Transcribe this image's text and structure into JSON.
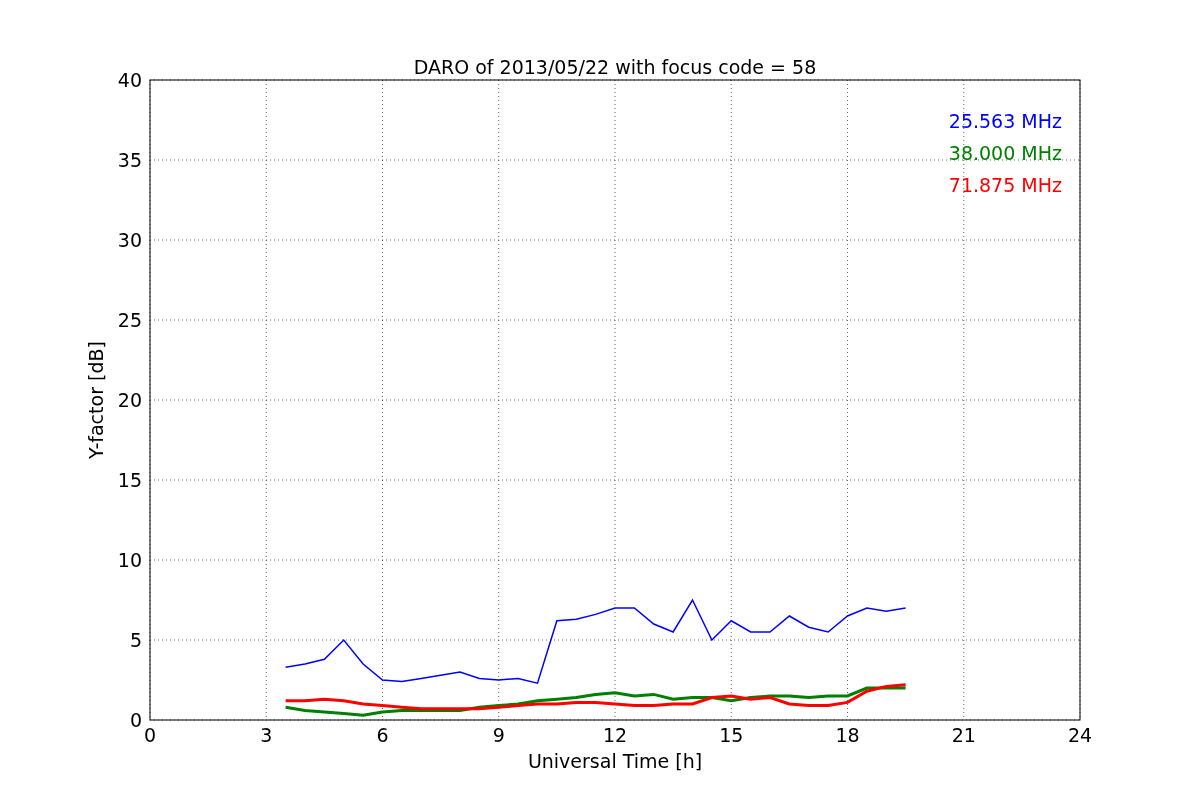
{
  "chart_data": {
    "type": "line",
    "title": "DARO of 2013/05/22 with focus code = 58",
    "xlabel": "Universal Time [h]",
    "ylabel": "Y-factor [dB]",
    "x": [
      3.5,
      4,
      4.5,
      5,
      5.5,
      6,
      6.5,
      7,
      7.5,
      8,
      8.5,
      9,
      9.5,
      10,
      10.5,
      11,
      11.5,
      12,
      12.5,
      13,
      13.5,
      14,
      14.5,
      15,
      15.5,
      16,
      16.5,
      17,
      17.5,
      18,
      18.5,
      19,
      19.5
    ],
    "series": [
      {
        "name": "25.563 MHz",
        "color": "#0000ff",
        "values": [
          3.3,
          3.5,
          3.8,
          5,
          3.5,
          2.5,
          2.4,
          2.6,
          2.8,
          3,
          2.6,
          2.5,
          2.6,
          2.3,
          6.2,
          6.3,
          6.6,
          7,
          7,
          6,
          5.5,
          7.5,
          5,
          6.2,
          5.5,
          5.5,
          6.5,
          5.8,
          5.5,
          6.5,
          7,
          6.8,
          7
        ]
      },
      {
        "name": "38.000 MHz",
        "color": "#008000",
        "values": [
          0.8,
          0.6,
          0.5,
          0.4,
          0.3,
          0.5,
          0.6,
          0.6,
          0.6,
          0.6,
          0.8,
          0.9,
          1,
          1.2,
          1.3,
          1.4,
          1.6,
          1.7,
          1.5,
          1.6,
          1.3,
          1.4,
          1.4,
          1.2,
          1.4,
          1.5,
          1.5,
          1.4,
          1.5,
          1.5,
          2,
          2,
          2
        ]
      },
      {
        "name": "71.875 MHz",
        "color": "#ff0000",
        "values": [
          1.2,
          1.2,
          1.3,
          1.2,
          1,
          0.9,
          0.8,
          0.7,
          0.7,
          0.7,
          0.7,
          0.8,
          0.9,
          1,
          1,
          1.1,
          1.1,
          1,
          0.9,
          0.9,
          1,
          1,
          1.4,
          1.5,
          1.3,
          1.4,
          1,
          0.9,
          0.9,
          1.1,
          1.8,
          2.1,
          2.2
        ]
      }
    ],
    "xlim": [
      0,
      24
    ],
    "ylim": [
      0,
      40
    ],
    "xticks": [
      0,
      3,
      6,
      9,
      12,
      15,
      18,
      21,
      24
    ],
    "yticks": [
      0,
      5,
      10,
      15,
      20,
      25,
      30,
      35,
      40
    ],
    "grid": true
  }
}
